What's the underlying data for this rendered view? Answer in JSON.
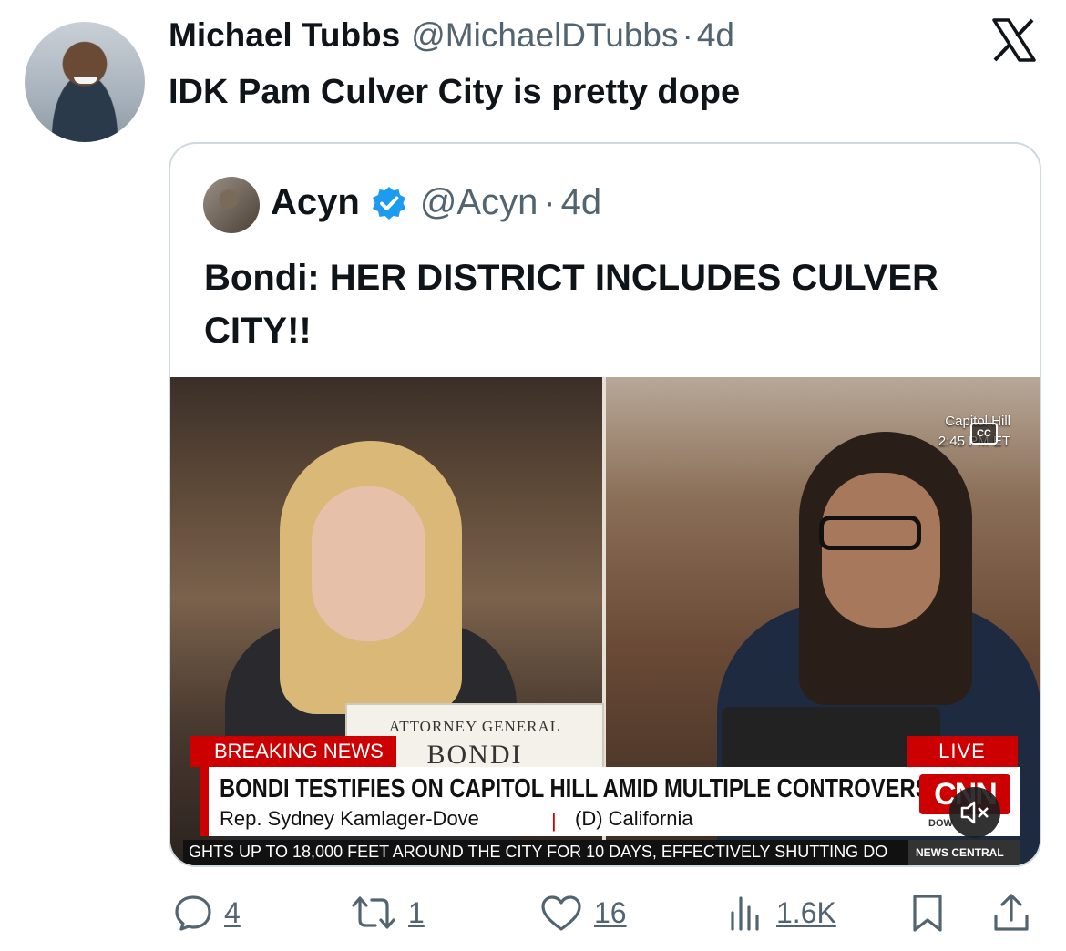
{
  "tweet": {
    "author_name": "Michael Tubbs",
    "author_handle": "@MichaelDTubbs",
    "separator": "·",
    "time": "4d",
    "text": "IDK Pam Culver City is pretty dope"
  },
  "quote": {
    "author_name": "Acyn",
    "author_handle": "@Acyn",
    "separator": "·",
    "time": "4d",
    "text": "Bondi: HER DISTRICT INCLUDES CULVER CITY!!",
    "verified_color": "#1d9bf0"
  },
  "video": {
    "location": "Capitol Hill",
    "clock": "2:45 PM ET",
    "cc_label": "CC",
    "nameplate_title": "ATTORNEY GENERAL",
    "nameplate_name": "BONDI",
    "breaking_label": "BREAKING NEWS",
    "live_label": "LIVE",
    "headline": "BONDI TESTIFIES ON CAPITOL HILL AMID MULTIPLE CONTROVERSIES",
    "speaker_name": "Rep. Sydney Kamlager-Dove",
    "speaker_sep": "|",
    "speaker_party": "(D) California",
    "network_logo": "CNN",
    "market_label": "DOW",
    "ticker_text": "GHTS UP TO 18,000 FEET AROUND THE CITY FOR 10 DAYS, EFFECTIVELY SHUTTING DO",
    "ticker_section": "NEWS CENTRAL",
    "accent_color": "#cc0000"
  },
  "actions": {
    "replies": "4",
    "reposts": "1",
    "likes": "16",
    "views": "1.6K"
  },
  "icons": {
    "platform": "x-logo-icon",
    "reply": "reply-icon",
    "repost": "repost-icon",
    "like": "heart-icon",
    "views": "views-icon",
    "bookmark": "bookmark-icon",
    "share": "share-icon"
  }
}
